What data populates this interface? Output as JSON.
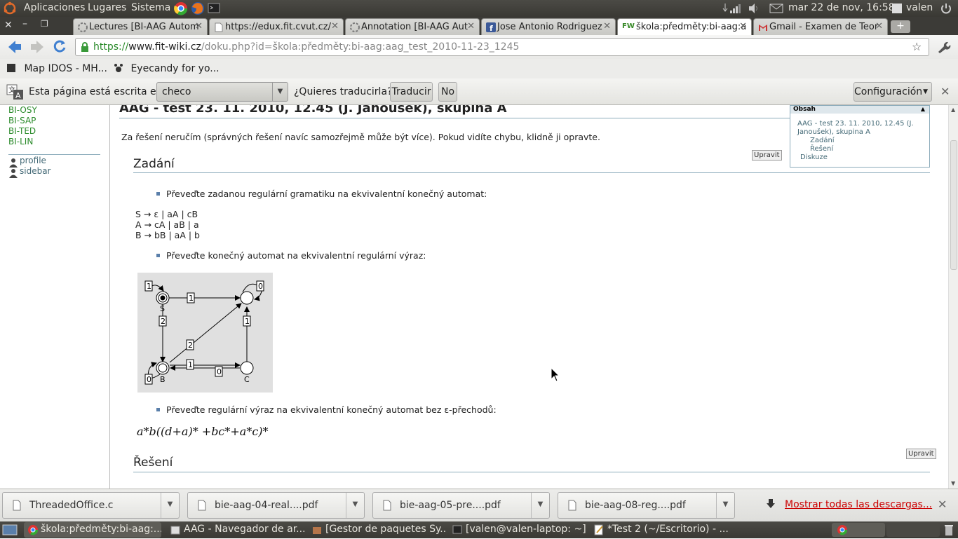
{
  "panel": {
    "menus": [
      "Aplicaciones",
      "Lugares",
      "Sistema"
    ],
    "datetime": "mar 22 de nov, 16:58",
    "user": "valen"
  },
  "tabs": [
    {
      "label": "Lectures [BI-AAG Autom",
      "icon": "wiki-icon"
    },
    {
      "label": "https://edux.fit.cvut.cz/",
      "icon": "page-icon"
    },
    {
      "label": "Annotation [BI-AAG Aut",
      "icon": "wiki-icon"
    },
    {
      "label": "Jose Antonio Rodriguez",
      "icon": "facebook-icon"
    },
    {
      "label": "škola:předměty:bi-aag:a",
      "icon": "fw-icon",
      "badge": "FW"
    },
    {
      "label": "Gmail - Examen de Teor",
      "icon": "gmail-icon"
    }
  ],
  "omnibox": {
    "url_scheme": "https://",
    "url_host": "www.fit-wiki.cz",
    "url_path": "/doku.php?id=škola:předměty:bi-aag:aag_test_2010-11-23_1245"
  },
  "bookmarks": [
    "Map IDOS - MH...",
    "Eyecandy for yo..."
  ],
  "translate": {
    "prompt": "Esta página está escrita en",
    "language": "checo",
    "question": "¿Quieres traducirla?",
    "translate_button": "Traducir",
    "no_button": "No",
    "settings_button": "Configuración"
  },
  "sidebar": {
    "links": [
      "BI-OSY",
      "BI-SAP",
      "BI-TED",
      "BI-LIN"
    ],
    "user_links": [
      "profile",
      "sidebar"
    ]
  },
  "page": {
    "title": "AAG - test 23. 11. 2010, 12.45 (J. Janoušek), skupina A",
    "intro": "Za řešení neručím (správných řešení navíc samozřejmě může být více). Pokud vidíte chybu, klidně ji opravte.",
    "edit_label": "Upravit",
    "section1": "Zadání",
    "task1": "Převeďte zadanou regulární gramatiku na ekvivalentní konečný automat:",
    "grammar": [
      "S → ε | aA | cB",
      "A → cA | aB | a",
      "B → bB | aA | b"
    ],
    "task2": "Převeďte konečný automat na ekvivalentní regulární výraz:",
    "task3": "Převeďte regulární výraz na ekvivalentní konečný automat bez ε-přechodů:",
    "regex": "a*b((d+a)* +bc*+a*c)*",
    "section2": "Řešení"
  },
  "automaton": {
    "states": [
      "S",
      "",
      "B",
      "C"
    ],
    "labels": [
      "1",
      "0",
      "1",
      "2",
      "1",
      "2",
      "1",
      "0",
      "0"
    ]
  },
  "toc": {
    "header": "Obsah",
    "items": [
      "AAG - test 23. 11. 2010, 12.45 (J. Janoušek), skupina A",
      "Zadání",
      "Řešení",
      "Diskuze"
    ]
  },
  "downloads": {
    "items": [
      "ThreadedOffice.c",
      "bie-aag-04-real....pdf",
      "bie-aag-05-pre....pdf",
      "bie-aag-08-reg....pdf"
    ],
    "show_all": "Mostrar todas las descargas..."
  },
  "taskbar": {
    "items": [
      "škola:předměty:bi-aag:...",
      "AAG - Navegador de ar...",
      "[Gestor de paquetes Sy...",
      "[valen@valen-laptop: ~]",
      "*Test 2 (~/Escritorio) - ..."
    ]
  }
}
